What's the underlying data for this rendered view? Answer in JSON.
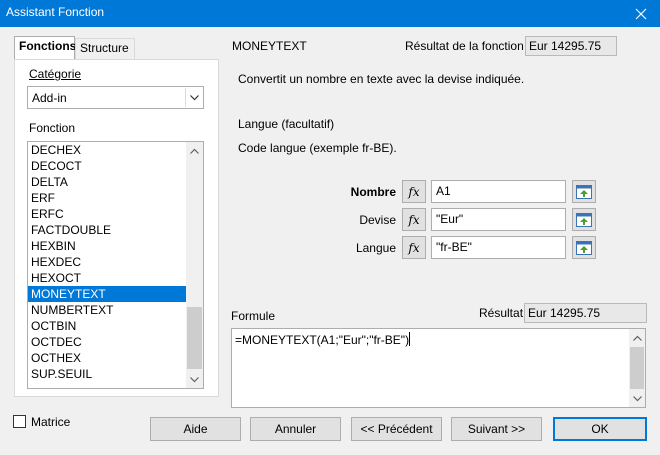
{
  "window": {
    "title": "Assistant Fonction"
  },
  "tabs": [
    {
      "label": "Fonctions"
    },
    {
      "label": "Structure"
    }
  ],
  "category": {
    "label": "Catégorie",
    "selected": "Add-in"
  },
  "function_list": {
    "label": "Fonction",
    "items": [
      "DECHEX",
      "DECOCT",
      "DELTA",
      "ERF",
      "ERFC",
      "FACTDOUBLE",
      "HEXBIN",
      "HEXDEC",
      "HEXOCT",
      "MONEYTEXT",
      "NUMBERTEXT",
      "OCTBIN",
      "OCTDEC",
      "OCTHEX",
      "SUP.SEUIL"
    ],
    "selected": "MONEYTEXT"
  },
  "function_info": {
    "name": "MONEYTEXT",
    "result_label": "Résultat de la fonction",
    "result_value": "Eur 14295.75",
    "description": "Convertit un nombre en texte avec la devise indiquée.",
    "arg_title": "Langue (facultatif)",
    "arg_description": "Code langue (exemple fr-BE)."
  },
  "arguments": [
    {
      "label": "Nombre",
      "value": "A1"
    },
    {
      "label": "Devise",
      "value": "\"Eur\""
    },
    {
      "label": "Langue",
      "value": "\"fr-BE\""
    }
  ],
  "icons": {
    "fx": "fx",
    "shrink": "shrink-icon"
  },
  "formula": {
    "label": "Formule",
    "result_label": "Résultat",
    "result_value": "Eur 14295.75",
    "text": "=MONEYTEXT(A1;\"Eur\";\"fr-BE\")"
  },
  "matrix": {
    "label": "Matrice",
    "checked": false
  },
  "buttons": {
    "help": "Aide",
    "cancel": "Annuler",
    "previous": "<< Précédent",
    "next": "Suivant >>",
    "ok": "OK"
  },
  "colors": {
    "titlebar": "#0078d7",
    "selection": "#0078d7"
  }
}
